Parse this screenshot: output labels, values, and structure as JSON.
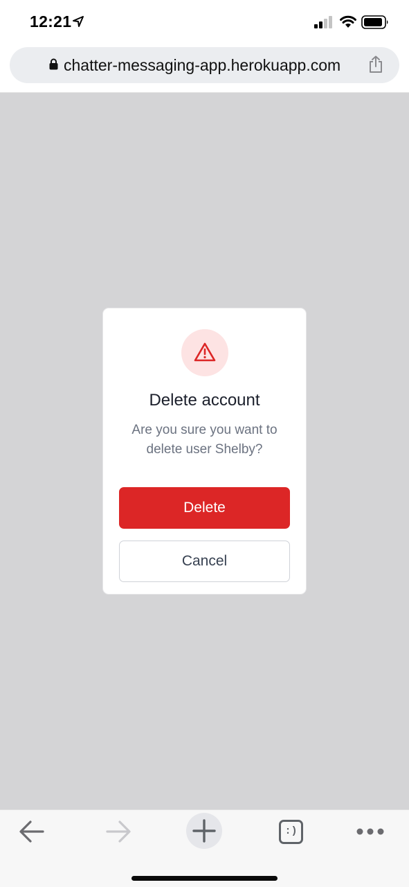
{
  "status_bar": {
    "time": "12:21",
    "icons": [
      "location-arrow-icon",
      "cellular-signal-icon",
      "wifi-icon",
      "battery-icon"
    ]
  },
  "browser": {
    "url": "chatter-messaging-app.herokuapp.com",
    "icons": [
      "lock-icon",
      "share-icon"
    ]
  },
  "dialog": {
    "icon": "warning-triangle-icon",
    "title": "Delete account",
    "message": "Are you sure you want to delete user Shelby?",
    "confirm_label": "Delete",
    "cancel_label": "Cancel"
  },
  "toolbar": {
    "tabs_label": ":)",
    "icons": [
      "back-arrow-icon",
      "forward-arrow-icon",
      "plus-icon",
      "tabs-icon",
      "more-icon"
    ]
  },
  "colors": {
    "danger": "#dc2626",
    "danger_light": "#fde3e3",
    "overlay": "#d4d4d6",
    "url_bar": "#ebedf0",
    "title_text": "#1b1f2b",
    "body_text": "#6b7280"
  }
}
